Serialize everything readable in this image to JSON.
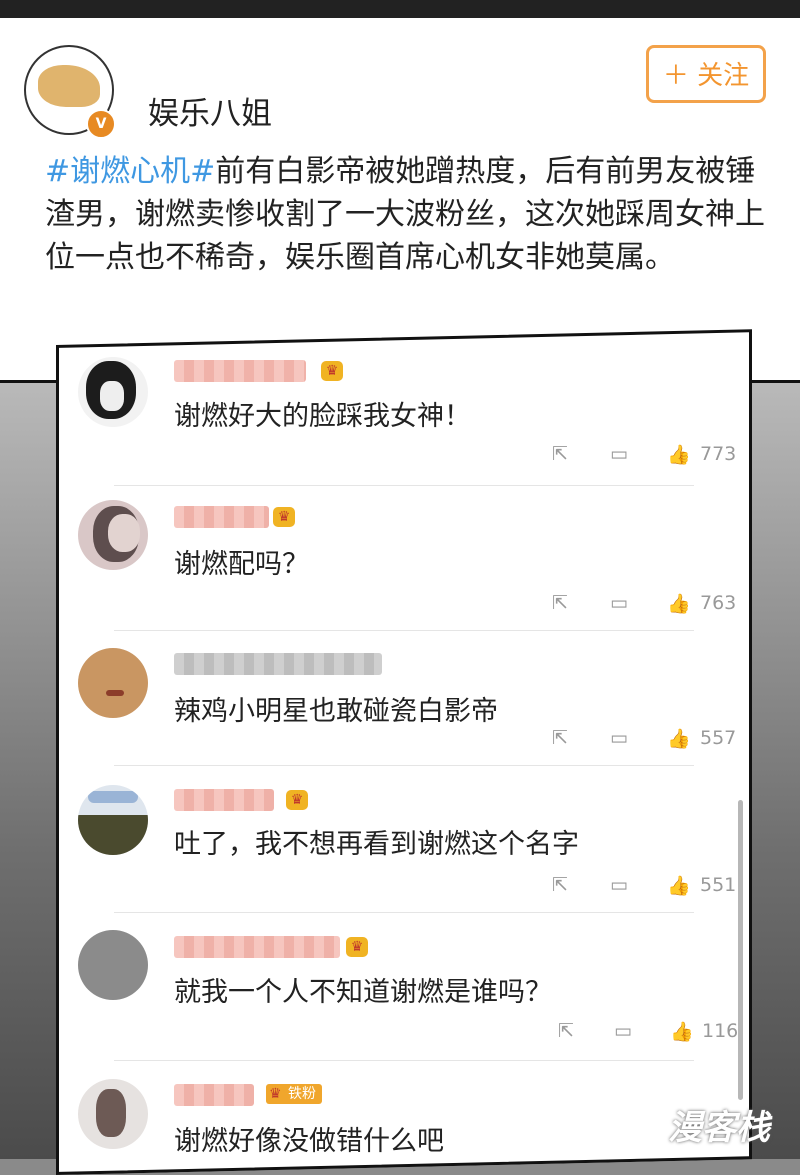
{
  "header": {
    "username": "娱乐八姐",
    "follow_label": "＋ 关注",
    "verified_badge": "V"
  },
  "post": {
    "hashtag": "#谢燃心机#",
    "body": "前有白影帝被她蹭热度，后有前男友被锤渣男，谢燃卖惨收割了一大波粉丝，这次她踩周女神上位一点也不稀奇，娱乐圈首席心机女非她莫属。"
  },
  "comments": [
    {
      "text": "谢燃好大的脸踩我女神！",
      "likes": "773",
      "badge": "crown"
    },
    {
      "text": "谢燃配吗？",
      "likes": "763",
      "badge": "crown"
    },
    {
      "text": "辣鸡小明星也敢碰瓷白影帝",
      "likes": "557",
      "badge": "none"
    },
    {
      "text": "吐了，我不想再看到谢燃这个名字",
      "likes": "551",
      "badge": "crown"
    },
    {
      "text": "就我一个人不知道谢燃是谁吗？",
      "likes": "116",
      "badge": "crown"
    },
    {
      "text": "谢燃好像没做错什么吧",
      "likes": "",
      "badge": "铁粉"
    }
  ],
  "icons": {
    "share": "share-icon",
    "comment": "comment-icon",
    "like": "like-icon"
  },
  "watermark": "漫客栈",
  "colors": {
    "hashtag": "#3f98e2",
    "follow": "#f3952f",
    "verified": "#e78a23",
    "crown": "#f0b323"
  }
}
